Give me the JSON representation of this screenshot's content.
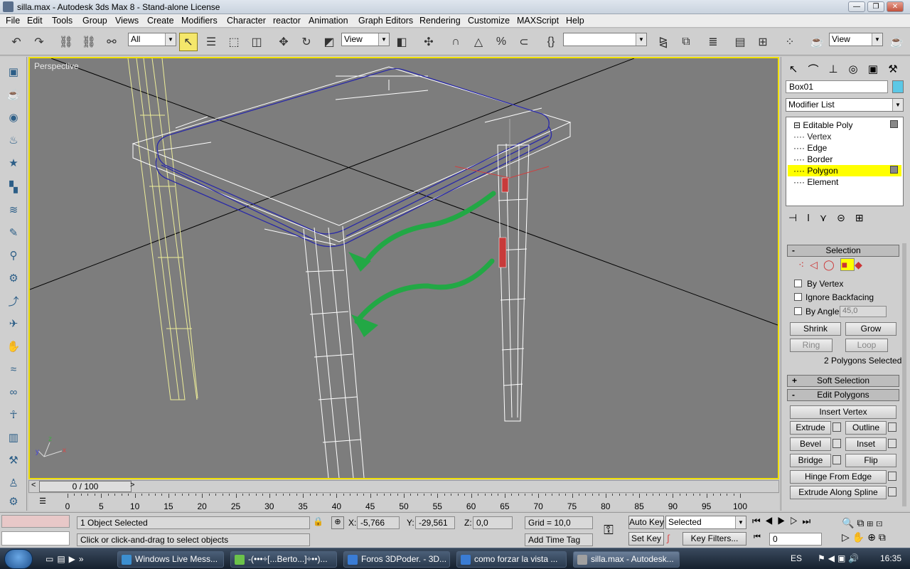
{
  "window": {
    "title": "silla.max - Autodesk 3ds Max 8  - Stand-alone License",
    "minimize": "—",
    "maximize": "❐",
    "close": "✕"
  },
  "menu": [
    "File",
    "Edit",
    "Tools",
    "Group",
    "Views",
    "Create",
    "Modifiers",
    "Character",
    "reactor",
    "Animation",
    "Graph Editors",
    "Rendering",
    "Customize",
    "MAXScript",
    "Help"
  ],
  "toolbar": {
    "selection_filter": "All",
    "ref_coord": "View",
    "named_selection": "",
    "ref_coord_right": "View"
  },
  "viewport": {
    "label": "Perspective",
    "axis_x": "x",
    "axis_y": "y",
    "axis_z": "z"
  },
  "timeline": {
    "slider_label": "0 / 100",
    "ticks": [
      "0",
      "5",
      "10",
      "15",
      "20",
      "25",
      "30",
      "35",
      "40",
      "45",
      "50",
      "55",
      "60",
      "65",
      "70",
      "75",
      "80",
      "85",
      "90",
      "95",
      "100"
    ]
  },
  "status": {
    "objects_selected": "1 Object Selected",
    "prompt": "Click or click-and-drag to select objects",
    "x_label": "X:",
    "x_value": "-5,766",
    "y_label": "Y:",
    "y_value": "-29,561",
    "z_label": "Z:",
    "z_value": "0,0",
    "grid": "Grid = 10,0",
    "add_time_tag": "Add Time Tag",
    "auto_key": "Auto Key",
    "set_key": "Set Key",
    "key_mode": "Selected",
    "key_filters": "Key Filters...",
    "frame": "0"
  },
  "cmdpanel": {
    "object_name": "Box01",
    "object_color": "#5bc8e6",
    "modifier_list": "Modifier List",
    "stack": [
      {
        "label": "Editable Poly",
        "prefix": "⊟"
      },
      {
        "label": "Vertex",
        "prefix": "····"
      },
      {
        "label": "Edge",
        "prefix": "····"
      },
      {
        "label": "Border",
        "prefix": "····"
      },
      {
        "label": "Polygon",
        "prefix": "····"
      },
      {
        "label": "Element",
        "prefix": "····"
      }
    ],
    "selection": {
      "header": "Selection",
      "by_vertex": "By Vertex",
      "ignore_backfacing": "Ignore Backfacing",
      "by_angle": "By Angle:",
      "angle_value": "45,0",
      "shrink": "Shrink",
      "grow": "Grow",
      "ring": "Ring",
      "loop": "Loop",
      "status": "2 Polygons Selected"
    },
    "soft_selection": "Soft Selection",
    "edit_polygons": {
      "header": "Edit Polygons",
      "insert_vertex": "Insert Vertex",
      "extrude": "Extrude",
      "outline": "Outline",
      "bevel": "Bevel",
      "inset": "Inset",
      "bridge": "Bridge",
      "flip": "Flip",
      "hinge": "Hinge From Edge",
      "extrude_spline": "Extrude Along Spline"
    },
    "plus": "+",
    "minus": "-"
  },
  "taskbar": {
    "tasks": [
      "Windows Live Mess...",
      "-(•••÷[...Berto...]÷••)...",
      "Foros 3DPoder. - 3D...",
      "como forzar la vista ...",
      "silla.max - Autodesk..."
    ],
    "lang": "ES",
    "clock": "16:35"
  },
  "colors": {
    "viewport_bg": "#7d7d7d",
    "selection_highlight": "#ffff00",
    "wire_white": "#ffffff",
    "wire_blue": "#2a2aa8",
    "annotation_green": "#22a845",
    "selected_poly": "#c83a3a"
  }
}
